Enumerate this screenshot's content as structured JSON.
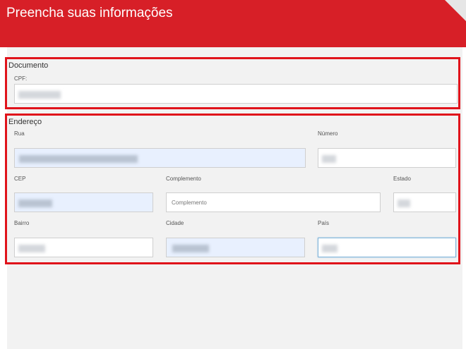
{
  "header": {
    "title": "Preencha suas informações",
    "color": "#d71f27"
  },
  "documento": {
    "legend": "Documento",
    "cpf": {
      "label": "CPF:",
      "value": ""
    }
  },
  "endereco": {
    "legend": "Endereço",
    "rua": {
      "label": "Rua",
      "value": ""
    },
    "numero": {
      "label": "Número",
      "value": ""
    },
    "cep": {
      "label": "CEP",
      "value": ""
    },
    "complemento": {
      "label": "Complemento",
      "placeholder": "Complemento",
      "value": ""
    },
    "estado": {
      "label": "Estado",
      "value": ""
    },
    "bairro": {
      "label": "Bairro",
      "value": ""
    },
    "cidade": {
      "label": "Cidade",
      "value": ""
    },
    "pais": {
      "label": "País",
      "value": ""
    }
  },
  "highlight_color": "#e0131b",
  "autofill_color": "#e8f0fe"
}
